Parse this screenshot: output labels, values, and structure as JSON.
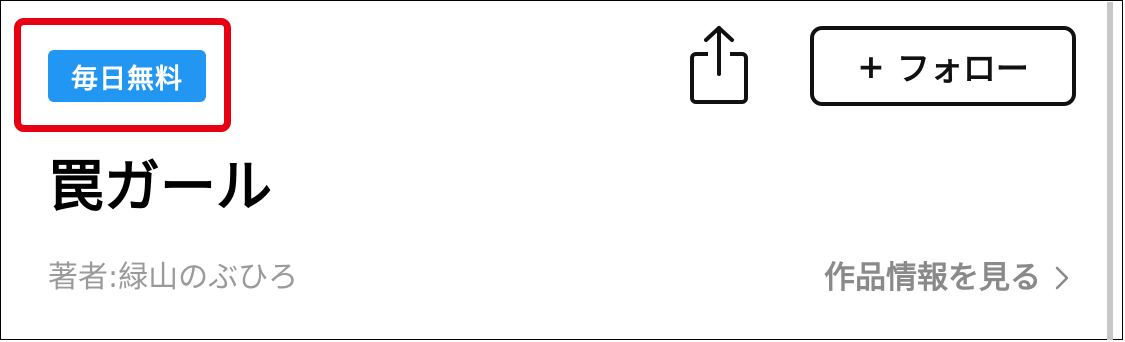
{
  "header": {
    "badge_label": "毎日無料",
    "follow_label": "フォロー",
    "follow_plus": "+"
  },
  "series": {
    "title": "罠ガール",
    "author": "著者:緑山のぶひろ",
    "info_link_label": "作品情報を見る"
  },
  "icons": {
    "share": "share-icon",
    "chevron": "chevron-right-icon"
  },
  "colors": {
    "badge_bg": "#2196f3",
    "highlight": "#e60012",
    "muted_text": "#9a9a9a"
  }
}
